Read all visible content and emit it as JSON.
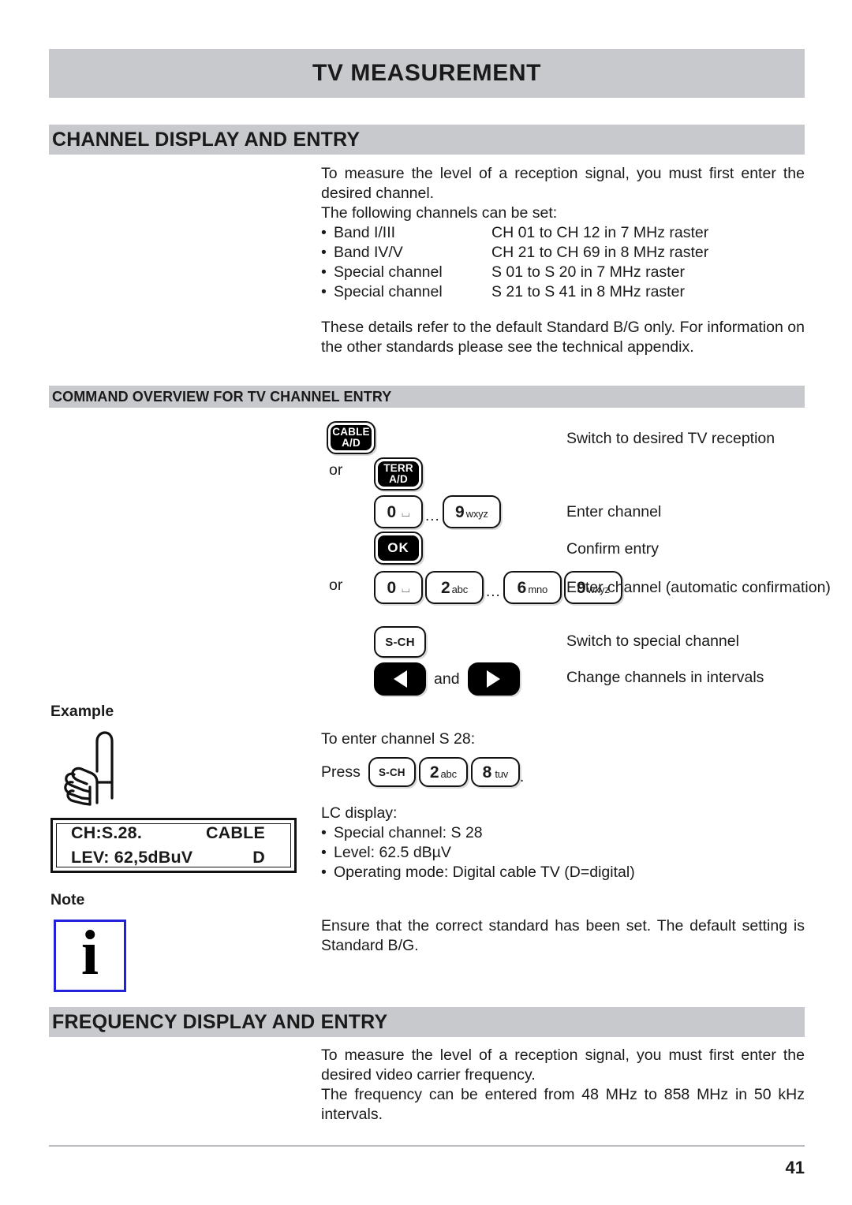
{
  "document": {
    "page_title": "TV MEASUREMENT",
    "page_number": "41"
  },
  "section_channel": {
    "heading": "CHANNEL DISPLAY AND ENTRY",
    "intro_1": "To measure the level of a reception signal, you must first enter the desired channel.",
    "intro_2": "The following channels can be set:",
    "channel_list": [
      {
        "bullet": "•",
        "name": "Band I/III",
        "range": "CH 01 to CH 12 in 7 MHz raster"
      },
      {
        "bullet": "•",
        "name": "Band IV/V",
        "range": "CH 21 to CH 69 in 8 MHz raster"
      },
      {
        "bullet": "•",
        "name": "Special channel",
        "range": "S 01 to S 20 in 7 MHz raster"
      },
      {
        "bullet": "•",
        "name": "Special channel",
        "range": "S 21 to S 41 in 8 MHz raster"
      }
    ],
    "note_standard": "These details refer to the default Standard B/G only. For information on the other standards please see the technical appendix."
  },
  "command_overview": {
    "heading": "COMMAND OVERVIEW FOR TV CHANNEL ENTRY",
    "or_1": "or",
    "or_2": "or",
    "and": "and",
    "ellipsis_1": "...",
    "ellipsis_2": "...",
    "keys": {
      "cable": {
        "line1": "CABLE",
        "line2": "A/D"
      },
      "terr": {
        "line1": "TERR",
        "line2": "A/D"
      },
      "zero": {
        "digit": "0",
        "letters": "⌴"
      },
      "nine": {
        "digit": "9",
        "letters": "wxyz"
      },
      "ok": {
        "label": "OK"
      },
      "two": {
        "digit": "2",
        "letters": "abc"
      },
      "six": {
        "digit": "6",
        "letters": "mno"
      },
      "sch": {
        "label": "S-CH"
      },
      "arrow_left": {
        "glyph": "◀"
      },
      "arrow_right": {
        "glyph": "▶"
      }
    },
    "descriptions": {
      "switch_reception": "Switch to desired TV reception",
      "enter_channel": "Enter channel",
      "confirm_entry": "Confirm entry",
      "enter_channel_auto": "Enter channel (automatic confirmation)",
      "switch_special": "Switch to special channel",
      "change_intervals": "Change channels in intervals"
    }
  },
  "example": {
    "label": "Example",
    "intro": "To enter channel S 28:",
    "press_label": "Press",
    "press_keys": {
      "sch": {
        "label": "S-CH"
      },
      "two": {
        "digit": "2",
        "letters": "abc"
      },
      "eight": {
        "digit": "8",
        "letters": "tuv"
      }
    },
    "press_period": ".",
    "lc_display_label": "LC display:",
    "lcd": {
      "line1_left": "CH:S.28.",
      "line1_right": "CABLE",
      "line2_left": "LEV: 62,5dBuV",
      "line2_right": "D"
    },
    "results": [
      {
        "bullet": "•",
        "text": "Special channel: S 28"
      },
      {
        "bullet": "•",
        "text": "Level: 62.5 dBµV"
      },
      {
        "bullet": "•",
        "text": "Operating mode: Digital cable TV (D=digital)"
      }
    ]
  },
  "note": {
    "label": "Note",
    "icon_char": "i",
    "icon_border_color": "#2222dd",
    "text": "Ensure that the correct standard has been set. The default setting is Standard B/G."
  },
  "section_frequency": {
    "heading": "FREQUENCY DISPLAY AND ENTRY",
    "para_1": "To measure the level of a reception signal, you must first enter the desired video carrier frequency.",
    "para_2": "The frequency can be entered from 48 MHz to 858 MHz in 50 kHz intervals."
  },
  "theme": {
    "band_gray": "#c8c9cd",
    "rule_gray": "#b9babf",
    "ink": "#1a1a1a"
  }
}
